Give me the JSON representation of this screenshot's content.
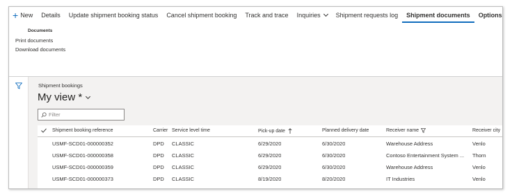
{
  "actionbar": {
    "new_label": "New",
    "items": [
      "Details",
      "Update shipment booking status",
      "Cancel shipment booking",
      "Track and trace",
      "Inquiries",
      "Shipment requests log",
      "Shipment documents",
      "Options"
    ],
    "active_tab": "Shipment documents"
  },
  "documents_menu": {
    "group_title": "Documents",
    "links": [
      "Print documents",
      "Download documents"
    ]
  },
  "page": {
    "caption": "Shipment bookings",
    "view_name": "My view *",
    "filter_placeholder": "Filter"
  },
  "grid": {
    "columns": [
      "Shipment booking reference",
      "Carrier",
      "Service level time",
      "Pick-up date",
      "Planned delivery date",
      "Receiver name",
      "Receiver city"
    ],
    "sort_column": "Pick-up date",
    "sort_direction": "ascending",
    "rows": [
      [
        "USMF-SCD01-000000352",
        "DPD",
        "CLASSIC",
        "6/29/2020",
        "6/30/2020",
        "Warehouse Address",
        "Venlo"
      ],
      [
        "USMF-SCD01-000000358",
        "DPD",
        "CLASSIC",
        "6/29/2020",
        "6/30/2020",
        "Contoso Entertainment System ...",
        "Thorn"
      ],
      [
        "USMF-SCD01-000000359",
        "DPD",
        "CLASSIC",
        "6/29/2020",
        "6/30/2020",
        "Warehouse Address",
        "Venlo"
      ],
      [
        "USMF-SCD01-000000373",
        "DPD",
        "CLASSIC",
        "8/19/2020",
        "8/20/2020",
        "IT Industries",
        "Venlo"
      ]
    ]
  },
  "colors": {
    "accent": "#0f6cbd",
    "content_bg": "#f3f2f1"
  },
  "icons": {
    "new": "plus-icon",
    "search": "search-icon",
    "filter_pane": "filter-icon",
    "sort": "sort-ascending-icon",
    "column_filter": "filter-icon",
    "select_all": "checkmark-icon"
  }
}
